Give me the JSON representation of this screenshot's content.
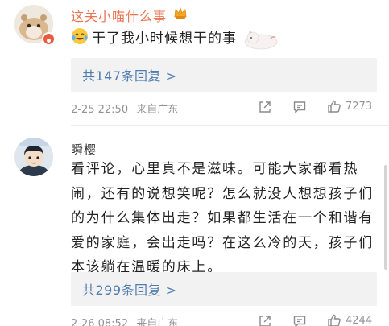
{
  "comments": [
    {
      "username": "这关小喵什么事",
      "text": "干了我小时候想干的事",
      "reply_label": "共147条回复 >",
      "date": "2-25 22:50",
      "source": "来自广东",
      "likes": "7273",
      "icons": {
        "avatar": "hamster-avatar",
        "badge": "vip-badge-icon",
        "crown": "crown-icon",
        "emoji": "laughing-tears-emoji-icon",
        "sticker": "cat-sticker-icon"
      },
      "colors": {
        "username": "#eb7350"
      }
    },
    {
      "username": "瞬樱",
      "text": "看评论，心里真不是滋味。可能大家都看热闹，还有的说想笑呢？怎么就没人想想孩子们的为什么集体出走？如果都生活在一个和谐有爱的家庭，会出走吗？在这么冷的天，孩子们本该躺在温暖的床上。",
      "reply_label": "共299条回复 >",
      "date": "2-26 08:52",
      "source": "来自广东",
      "likes": "4244",
      "icons": {
        "avatar": "cartoon-boy-avatar"
      },
      "colors": {
        "username": "#333333"
      }
    }
  ],
  "action_icons": [
    "share-icon",
    "comment-icon",
    "like-icon"
  ],
  "colors": {
    "link": "#507daf",
    "meta": "#939393",
    "reply_bg": "#f2f2f2"
  }
}
